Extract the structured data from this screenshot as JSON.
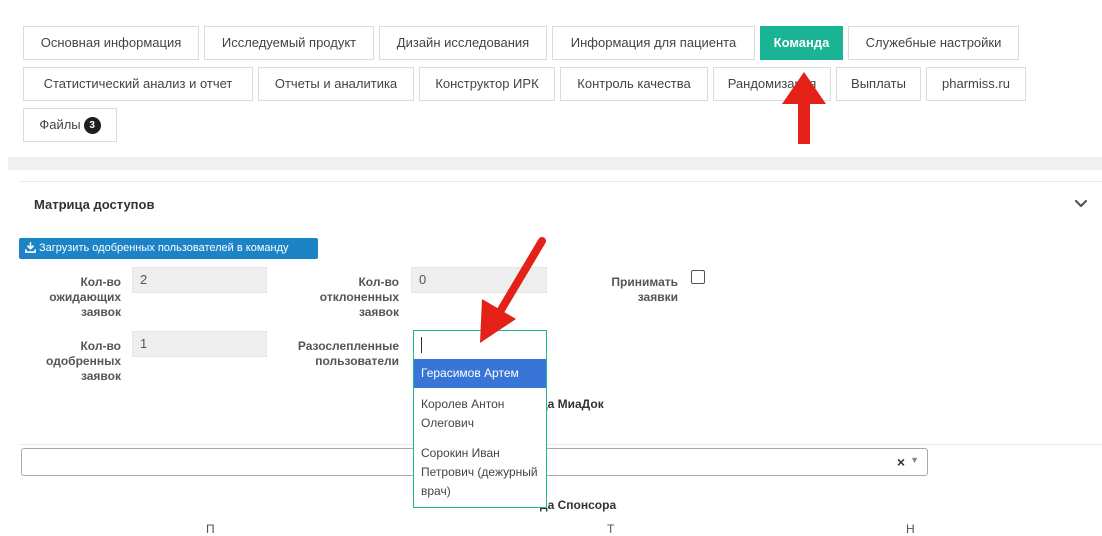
{
  "tabs": [
    {
      "label": "Основная информация",
      "active": false
    },
    {
      "label": "Исследуемый продукт",
      "active": false
    },
    {
      "label": "Дизайн исследования",
      "active": false
    },
    {
      "label": "Информация для пациента",
      "active": false
    },
    {
      "label": "Команда",
      "active": true
    },
    {
      "label": "Служебные настройки",
      "active": false
    },
    {
      "label": "Статистический анализ и отчет",
      "active": false
    },
    {
      "label": "Отчеты и аналитика",
      "active": false
    },
    {
      "label": "Конструктор ИРК",
      "active": false
    },
    {
      "label": "Контроль качества",
      "active": false
    },
    {
      "label": "Рандомизация",
      "active": false
    },
    {
      "label": "Выплаты",
      "active": false
    },
    {
      "label": "pharmiss.ru",
      "active": false
    },
    {
      "label": "Файлы",
      "badge": "3",
      "active": false
    }
  ],
  "panel": {
    "title": "Матрица доступов",
    "upload_button": "Загрузить одобренных пользователей в команду"
  },
  "form": {
    "pending_label": "Кол-во ожидающих заявок",
    "pending_value": "2",
    "rejected_label": "Кол-во отклоненных заявок",
    "rejected_value": "0",
    "accept_label": "Принимать заявки",
    "accept_checked": false,
    "approved_label": "Кол-во одобренных заявок",
    "approved_value": "1",
    "unblinded_label": "Разослепленные пользователи",
    "unblinded_search_value": ""
  },
  "dropdown_options": [
    {
      "label": "Герасимов Артем",
      "highlighted": true
    },
    {
      "label": "Королев Антон Олегович",
      "highlighted": false
    },
    {
      "label": "Сорокин Иван Петрович (дежурный врач)",
      "highlighted": false
    }
  ],
  "sections": {
    "miadok_suffix": "да МиаДок",
    "sponsor_suffix": "да Спонсора"
  },
  "team_select": {
    "value": "",
    "clear": "×",
    "arrow": "▼"
  },
  "bottom_cut": [
    "П",
    "Т",
    "Н"
  ],
  "colors": {
    "accent": "#1ab394",
    "primary": "#1c84c6",
    "highlight": "#3875d7",
    "arrow": "#e32117"
  }
}
